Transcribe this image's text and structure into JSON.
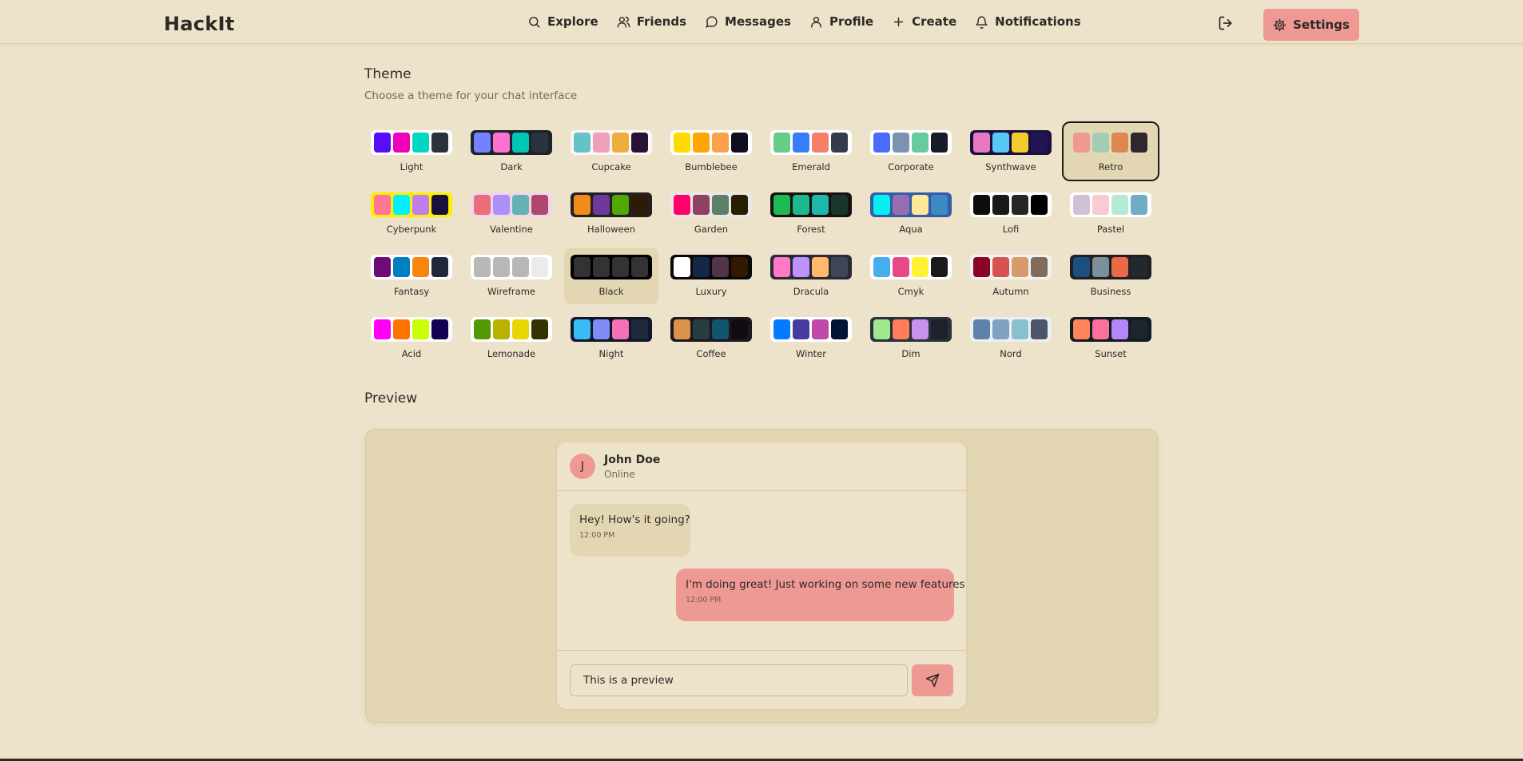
{
  "brand": "HackIt",
  "nav": [
    {
      "label": "Explore",
      "icon": "search-icon"
    },
    {
      "label": "Friends",
      "icon": "users-icon"
    },
    {
      "label": "Messages",
      "icon": "message-circle-icon"
    },
    {
      "label": "Profile",
      "icon": "user-icon"
    },
    {
      "label": "Create",
      "icon": "plus-icon"
    },
    {
      "label": "Notifications",
      "icon": "bell-icon"
    }
  ],
  "settings_label": "Settings",
  "theme_section": {
    "title": "Theme",
    "subtitle": "Choose a theme for your chat interface",
    "selected": "Retro",
    "themes": [
      {
        "name": "Light",
        "bg": "#ffffff",
        "colors": [
          "#570df8",
          "#f000b8",
          "#00d7c0",
          "#2a323c"
        ]
      },
      {
        "name": "Dark",
        "bg": "#1d232a",
        "colors": [
          "#7582ff",
          "#ff71cf",
          "#00c7b5",
          "#2a323c"
        ]
      },
      {
        "name": "Cupcake",
        "bg": "#faf7f5",
        "colors": [
          "#65c3c8",
          "#ef9fbc",
          "#eeaf3a",
          "#291334"
        ]
      },
      {
        "name": "Bumblebee",
        "bg": "#ffffff",
        "colors": [
          "#ffd900",
          "#ffa400",
          "#fba147",
          "#0e0c1f"
        ]
      },
      {
        "name": "Emerald",
        "bg": "#ffffff",
        "colors": [
          "#66cc8a",
          "#377cfb",
          "#f68067",
          "#333c4d"
        ]
      },
      {
        "name": "Corporate",
        "bg": "#ffffff",
        "colors": [
          "#4b6bfb",
          "#7b92b2",
          "#67cba0",
          "#181a2a"
        ]
      },
      {
        "name": "Synthwave",
        "bg": "#1a103d",
        "colors": [
          "#e779c1",
          "#58c7f3",
          "#f3cc30",
          "#221551"
        ]
      },
      {
        "name": "Retro",
        "bg": "#e4d8b4",
        "colors": [
          "#ef9995",
          "#a4cbb4",
          "#dc8850",
          "#2e282a"
        ]
      },
      {
        "name": "Cyberpunk",
        "bg": "#ffee00",
        "colors": [
          "#ff7598",
          "#00f0ff",
          "#c07eec",
          "#1a103d"
        ]
      },
      {
        "name": "Valentine",
        "bg": "#f0d6e8",
        "colors": [
          "#e96d7b",
          "#a991f7",
          "#66b1b3",
          "#af4670"
        ]
      },
      {
        "name": "Halloween",
        "bg": "#212121",
        "colors": [
          "#f28c18",
          "#6d3a9c",
          "#51a800",
          "#2f1b05"
        ]
      },
      {
        "name": "Garden",
        "bg": "#e9e7e7",
        "colors": [
          "#ff006e",
          "#8e4162",
          "#5c7f67",
          "#291e00"
        ]
      },
      {
        "name": "Forest",
        "bg": "#171212",
        "colors": [
          "#1eb854",
          "#1db88e",
          "#1db8ab",
          "#19362d"
        ]
      },
      {
        "name": "Aqua",
        "bg": "#345da7",
        "colors": [
          "#09ecf3",
          "#966fb3",
          "#ffe999",
          "#3b8ac4"
        ]
      },
      {
        "name": "Lofi",
        "bg": "#ffffff",
        "colors": [
          "#0d0d0d",
          "#1a1919",
          "#262626",
          "#000000"
        ]
      },
      {
        "name": "Pastel",
        "bg": "#ffffff",
        "colors": [
          "#d1c1d7",
          "#f6cbd1",
          "#b4e9d6",
          "#70acc7"
        ]
      },
      {
        "name": "Fantasy",
        "bg": "#ffffff",
        "colors": [
          "#6e0b75",
          "#007ebd",
          "#f8860d",
          "#1f2937"
        ]
      },
      {
        "name": "Wireframe",
        "bg": "#ffffff",
        "colors": [
          "#b8b8b8",
          "#b8b8b8",
          "#b8b8b8",
          "#ebebeb"
        ]
      },
      {
        "name": "Black",
        "bg": "#000000",
        "colors": [
          "#343232",
          "#343232",
          "#343232",
          "#343232"
        ]
      },
      {
        "name": "Luxury",
        "bg": "#09090b",
        "colors": [
          "#ffffff",
          "#152747",
          "#513448",
          "#331800"
        ]
      },
      {
        "name": "Dracula",
        "bg": "#282a36",
        "colors": [
          "#ff79c6",
          "#bd93f9",
          "#ffb86c",
          "#414558"
        ]
      },
      {
        "name": "Cmyk",
        "bg": "#ffffff",
        "colors": [
          "#45aeee",
          "#e8488a",
          "#fff232",
          "#1a1a1a"
        ]
      },
      {
        "name": "Autumn",
        "bg": "#f1f1f1",
        "colors": [
          "#8c0327",
          "#d85251",
          "#d59b6a",
          "#826a5c"
        ]
      },
      {
        "name": "Business",
        "bg": "#202020",
        "colors": [
          "#1c4e80",
          "#7c909a",
          "#ea6947",
          "#23282e"
        ]
      },
      {
        "name": "Acid",
        "bg": "#fafafa",
        "colors": [
          "#ff00f4",
          "#ff7400",
          "#cbfd03",
          "#140151"
        ]
      },
      {
        "name": "Lemonade",
        "bg": "#ffffff",
        "colors": [
          "#519903",
          "#b8b100",
          "#e9d404",
          "#343300"
        ]
      },
      {
        "name": "Night",
        "bg": "#0f1729",
        "colors": [
          "#38bdf8",
          "#818cf8",
          "#f471b5",
          "#1e293b"
        ]
      },
      {
        "name": "Coffee",
        "bg": "#20161f",
        "colors": [
          "#db924b",
          "#263e3f",
          "#10576d",
          "#120c12"
        ]
      },
      {
        "name": "Winter",
        "bg": "#ffffff",
        "colors": [
          "#047aff",
          "#463aa2",
          "#c148ac",
          "#021431"
        ]
      },
      {
        "name": "Dim",
        "bg": "#2a303c",
        "colors": [
          "#9fe88d",
          "#ff7d5c",
          "#c792e9",
          "#1c212b"
        ]
      },
      {
        "name": "Nord",
        "bg": "#eceff4",
        "colors": [
          "#5e81ac",
          "#81a1c1",
          "#88c0d0",
          "#4c566a"
        ]
      },
      {
        "name": "Sunset",
        "bg": "#121c22",
        "colors": [
          "#ff865b",
          "#fd6f9c",
          "#b387fa",
          "#1b262c"
        ]
      }
    ]
  },
  "preview": {
    "title": "Preview",
    "contact": {
      "initial": "J",
      "name": "John Doe",
      "status": "Online"
    },
    "messages": [
      {
        "text": "Hey! How's it going?",
        "time": "12:00 PM",
        "sent": false
      },
      {
        "text": "I'm doing great! Just working on some new features.",
        "time": "12:00 PM",
        "sent": true
      }
    ],
    "input_value": "This is a preview"
  },
  "colors": {
    "accent": "#ef9995",
    "background": "#ede3ca",
    "surface": "#e3d7b3",
    "text": "#2d2a26"
  }
}
